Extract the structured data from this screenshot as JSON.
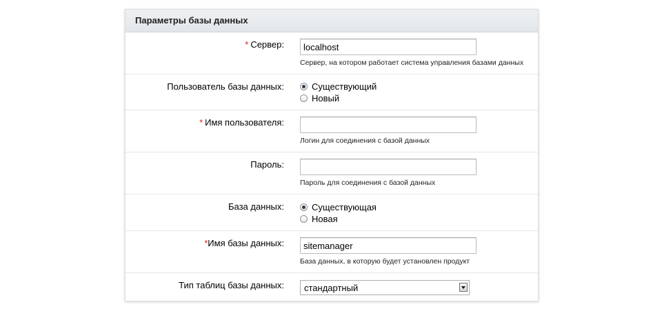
{
  "panel": {
    "title": "Параметры базы данных"
  },
  "fields": {
    "server": {
      "label": "Сервер:",
      "required_mark": "*",
      "value": "localhost",
      "hint": "Сервер, на котором работает система управления базами данных"
    },
    "db_user": {
      "label": "Пользователь базы данных:",
      "options": [
        {
          "label": "Существующий",
          "checked": true
        },
        {
          "label": "Новый",
          "checked": false
        }
      ]
    },
    "username": {
      "label": "Имя пользователя:",
      "required_mark": "*",
      "value": "",
      "hint": "Логин для соединения с базой данных"
    },
    "password": {
      "label": "Пароль:",
      "value": "",
      "hint": "Пароль для соединения с базой данных"
    },
    "database": {
      "label": "База данных:",
      "options": [
        {
          "label": "Существующая",
          "checked": true
        },
        {
          "label": "Новая",
          "checked": false
        }
      ]
    },
    "db_name": {
      "label": "Имя базы данных:",
      "required_mark": "*",
      "value": "sitemanager",
      "hint": "База данных, в которую будет установлен продукт"
    },
    "table_type": {
      "label": "Тип таблиц базы данных:",
      "selected": "стандартный"
    }
  },
  "colors": {
    "required": "#e31b1b",
    "header_bg": "#e6eaec",
    "row_border": "#e4e6e8"
  }
}
